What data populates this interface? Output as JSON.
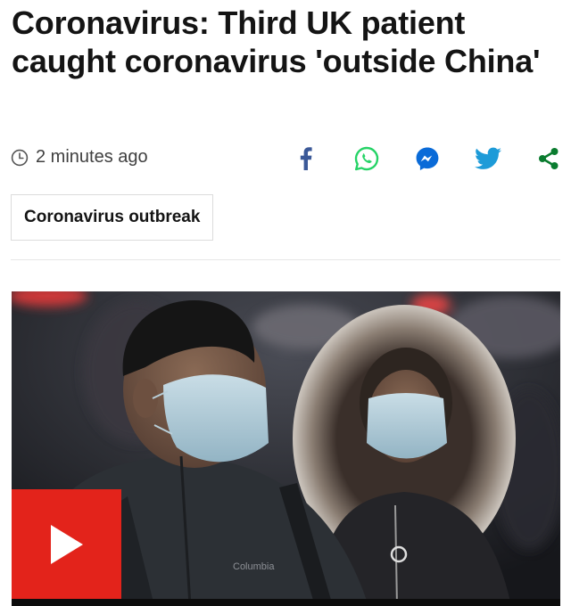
{
  "article": {
    "headline": "Coronavirus: Third UK patient caught coronavirus 'outside China'",
    "timestamp": "2 minutes ago",
    "tag": "Coronavirus outbreak",
    "media": {
      "description": "Video thumbnail: two people wearing surgical face masks",
      "jacket_logo_text": "Columbia"
    }
  },
  "share": {
    "items": [
      {
        "name": "facebook",
        "icon": "facebook-icon",
        "color": "#3b5998"
      },
      {
        "name": "whatsapp",
        "icon": "whatsapp-icon",
        "color": "#25d366"
      },
      {
        "name": "messenger",
        "icon": "messenger-icon",
        "color": "#0084ff"
      },
      {
        "name": "twitter",
        "icon": "twitter-icon",
        "color": "#1da1f2"
      },
      {
        "name": "share",
        "icon": "share-icon",
        "color": "#0a7c2f"
      }
    ]
  },
  "colors": {
    "headline": "#141414",
    "timestamp": "#404040",
    "play_button": "#e3231b"
  }
}
